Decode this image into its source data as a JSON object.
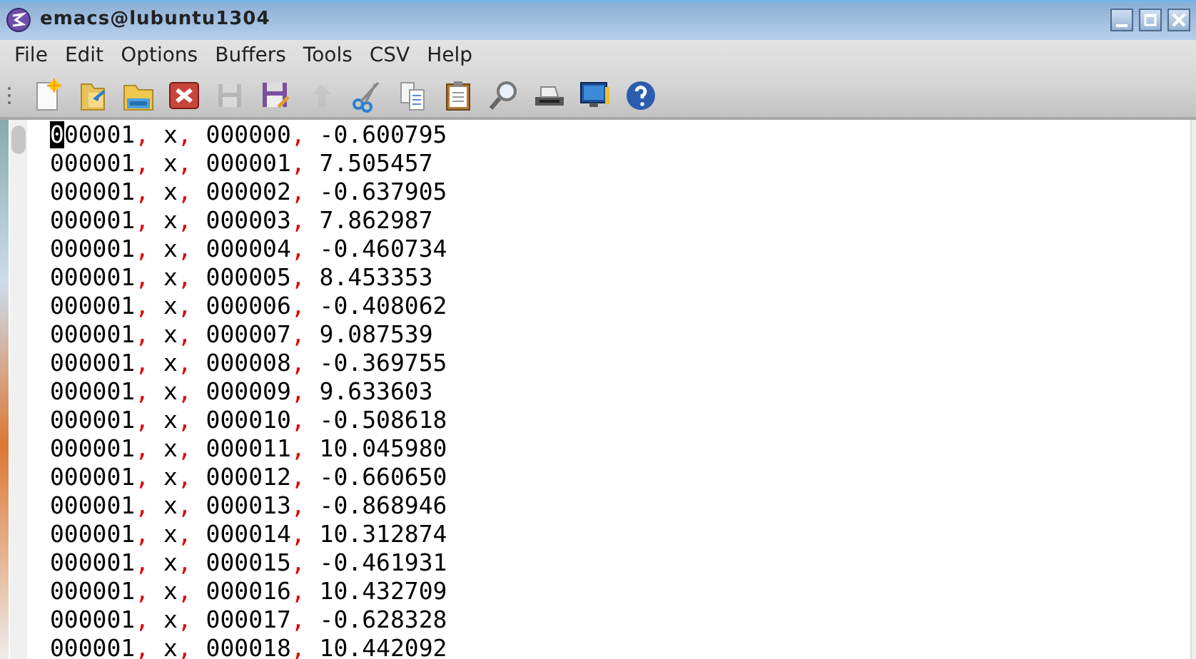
{
  "window": {
    "title": "emacs@lubuntu1304"
  },
  "menu": [
    "File",
    "Edit",
    "Options",
    "Buffers",
    "Tools",
    "CSV",
    "Help"
  ],
  "toolbar": [
    {
      "kind": "new",
      "disabled": false
    },
    {
      "kind": "open",
      "disabled": false
    },
    {
      "kind": "folder",
      "disabled": false
    },
    {
      "kind": "close",
      "disabled": false
    },
    {
      "kind": "save",
      "disabled": true
    },
    {
      "kind": "saveas",
      "disabled": false
    },
    {
      "kind": "undo",
      "disabled": true
    },
    {
      "kind": "cut",
      "disabled": false
    },
    {
      "kind": "copy",
      "disabled": false
    },
    {
      "kind": "paste",
      "disabled": false
    },
    {
      "kind": "search",
      "disabled": false
    },
    {
      "kind": "print",
      "disabled": false
    },
    {
      "kind": "prefs",
      "disabled": false
    },
    {
      "kind": "help",
      "disabled": false
    }
  ],
  "lines": [
    {
      "cursor": true,
      "tokens": [
        "000001",
        ",",
        " x",
        ",",
        " 000000",
        ",",
        " -0.600795"
      ]
    },
    {
      "cursor": false,
      "tokens": [
        "000001",
        ",",
        " x",
        ",",
        " 000001",
        ",",
        " 7.505457"
      ]
    },
    {
      "cursor": false,
      "tokens": [
        "000001",
        ",",
        " x",
        ",",
        " 000002",
        ",",
        " -0.637905"
      ]
    },
    {
      "cursor": false,
      "tokens": [
        "000001",
        ",",
        " x",
        ",",
        " 000003",
        ",",
        " 7.862987"
      ]
    },
    {
      "cursor": false,
      "tokens": [
        "000001",
        ",",
        " x",
        ",",
        " 000004",
        ",",
        " -0.460734"
      ]
    },
    {
      "cursor": false,
      "tokens": [
        "000001",
        ",",
        " x",
        ",",
        " 000005",
        ",",
        " 8.453353"
      ]
    },
    {
      "cursor": false,
      "tokens": [
        "000001",
        ",",
        " x",
        ",",
        " 000006",
        ",",
        " -0.408062"
      ]
    },
    {
      "cursor": false,
      "tokens": [
        "000001",
        ",",
        " x",
        ",",
        " 000007",
        ",",
        " 9.087539"
      ]
    },
    {
      "cursor": false,
      "tokens": [
        "000001",
        ",",
        " x",
        ",",
        " 000008",
        ",",
        " -0.369755"
      ]
    },
    {
      "cursor": false,
      "tokens": [
        "000001",
        ",",
        " x",
        ",",
        " 000009",
        ",",
        " 9.633603"
      ]
    },
    {
      "cursor": false,
      "tokens": [
        "000001",
        ",",
        " x",
        ",",
        " 000010",
        ",",
        " -0.508618"
      ]
    },
    {
      "cursor": false,
      "tokens": [
        "000001",
        ",",
        " x",
        ",",
        " 000011",
        ",",
        " 10.045980"
      ]
    },
    {
      "cursor": false,
      "tokens": [
        "000001",
        ",",
        " x",
        ",",
        " 000012",
        ",",
        " -0.660650"
      ]
    },
    {
      "cursor": false,
      "tokens": [
        "000001",
        ",",
        " x",
        ",",
        " 000013",
        ",",
        " -0.868946"
      ]
    },
    {
      "cursor": false,
      "tokens": [
        "000001",
        ",",
        " x",
        ",",
        " 000014",
        ",",
        " 10.312874"
      ]
    },
    {
      "cursor": false,
      "tokens": [
        "000001",
        ",",
        " x",
        ",",
        " 000015",
        ",",
        " -0.461931"
      ]
    },
    {
      "cursor": false,
      "tokens": [
        "000001",
        ",",
        " x",
        ",",
        " 000016",
        ",",
        " 10.432709"
      ]
    },
    {
      "cursor": false,
      "tokens": [
        "000001",
        ",",
        " x",
        ",",
        " 000017",
        ",",
        " -0.628328"
      ]
    },
    {
      "cursor": false,
      "tokens": [
        "000001",
        ",",
        " x",
        ",",
        " 000018",
        ",",
        " 10.442092"
      ]
    }
  ]
}
